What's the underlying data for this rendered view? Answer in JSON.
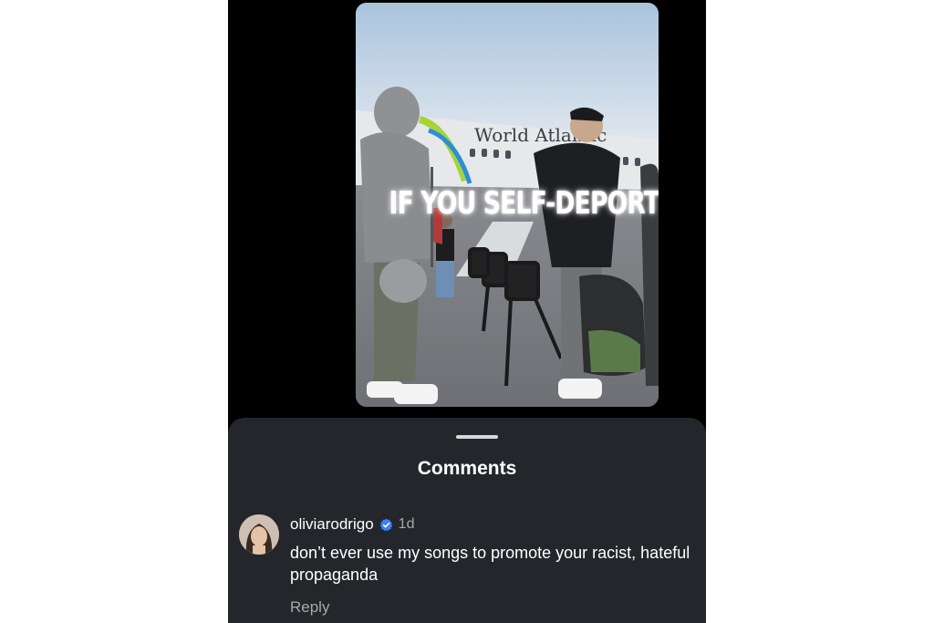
{
  "video": {
    "overlay_text": "IF YOU SELF-DEPORT",
    "plane_livery": "World Atlantic"
  },
  "comments_sheet": {
    "title": "Comments",
    "comments": [
      {
        "username": "oliviarodrigo",
        "verified": true,
        "time": "1d",
        "text": "don’t ever use my songs to promote your racist, hateful propaganda",
        "reply_label": "Reply"
      }
    ]
  },
  "colors": {
    "sheet_bg": "#24262b",
    "phone_bg": "#000000",
    "verified_blue": "#3b82f6",
    "muted_text": "#a8a8a8"
  },
  "icons": {
    "verified": "verified-badge-icon"
  }
}
